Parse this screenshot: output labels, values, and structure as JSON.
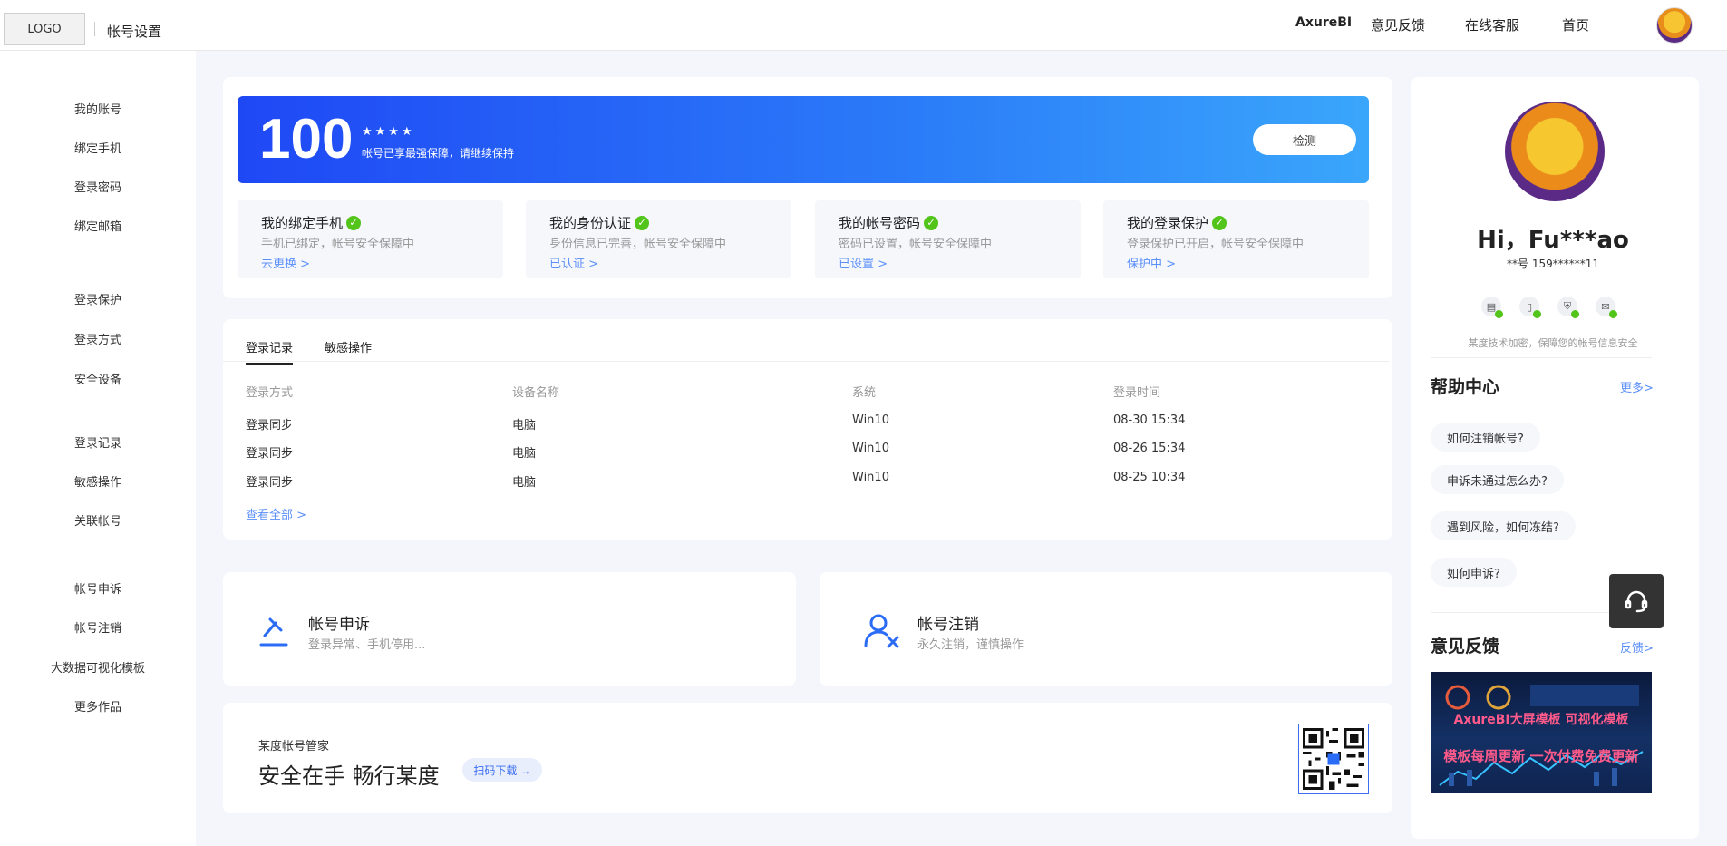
{
  "header": {
    "logo": "LOGO",
    "page_name": "帐号设置",
    "nav": [
      "AxureBI",
      "意见反馈",
      "在线客服",
      "首页"
    ]
  },
  "sidebar": {
    "groups": [
      [
        "我的账号",
        "绑定手机",
        "登录密码",
        "绑定邮箱"
      ],
      [
        "登录保护",
        "登录方式",
        "安全设备"
      ],
      [
        "登录记录",
        "敏感操作",
        "关联帐号"
      ],
      [
        "帐号申诉",
        "帐号注销",
        "大数据可视化模板",
        "更多作品"
      ]
    ]
  },
  "score": {
    "value": "100",
    "stars": "★★★★",
    "desc": "帐号已享最强保障，请继续保持",
    "button": "检测"
  },
  "security_items": [
    {
      "title": "我的绑定手机",
      "desc": "手机已绑定，帐号安全保障中",
      "link": "去更换 >"
    },
    {
      "title": "我的身份认证",
      "desc": "身份信息已完善，帐号安全保障中",
      "link": "已认证 >"
    },
    {
      "title": "我的帐号密码",
      "desc": "密码已设置，帐号安全保障中",
      "link": "已设置 >"
    },
    {
      "title": "我的登录保护",
      "desc": "登录保护已开启，帐号安全保障中",
      "link": "保护中 >"
    }
  ],
  "records": {
    "tabs": [
      "登录记录",
      "敏感操作"
    ],
    "columns": [
      "登录方式",
      "设备名称",
      "系统",
      "登录时间"
    ],
    "rows": [
      [
        "登录同步",
        "电脑",
        "Win10",
        "08-30 15:34"
      ],
      [
        "登录同步",
        "电脑",
        "Win10",
        "08-26 15:34"
      ],
      [
        "登录同步",
        "电脑",
        "Win10",
        "08-25 10:34"
      ]
    ],
    "view_all": "查看全部 >"
  },
  "actions": [
    {
      "title": "帐号申诉",
      "desc": "登录异常、手机停用..."
    },
    {
      "title": "帐号注销",
      "desc": "永久注销，谨慎操作"
    }
  ],
  "manager": {
    "label": "某度帐号管家",
    "slogan": "安全在手 畅行某度",
    "scan": "扫码下载 →"
  },
  "profile": {
    "greeting": "Hi，Fu***ao",
    "account": "**号  159******11",
    "secure_note": "某度技术加密，保障您的帐号信息安全"
  },
  "help": {
    "title": "帮助中心",
    "more": "更多>",
    "items": [
      "如何注销帐号?",
      "申诉未通过怎么办?",
      "遇到风险，如何冻结?",
      "如何申诉?"
    ]
  },
  "feedback": {
    "title": "意见反馈",
    "more": "反馈>",
    "banner_line1": "AxureBI大屏模板 可视化模板",
    "banner_line2": "模板每周更新 一次付费免费更新"
  },
  "colors": {
    "primary": "#1f48f5",
    "link": "#5b8ff9",
    "success": "#52c41a"
  }
}
